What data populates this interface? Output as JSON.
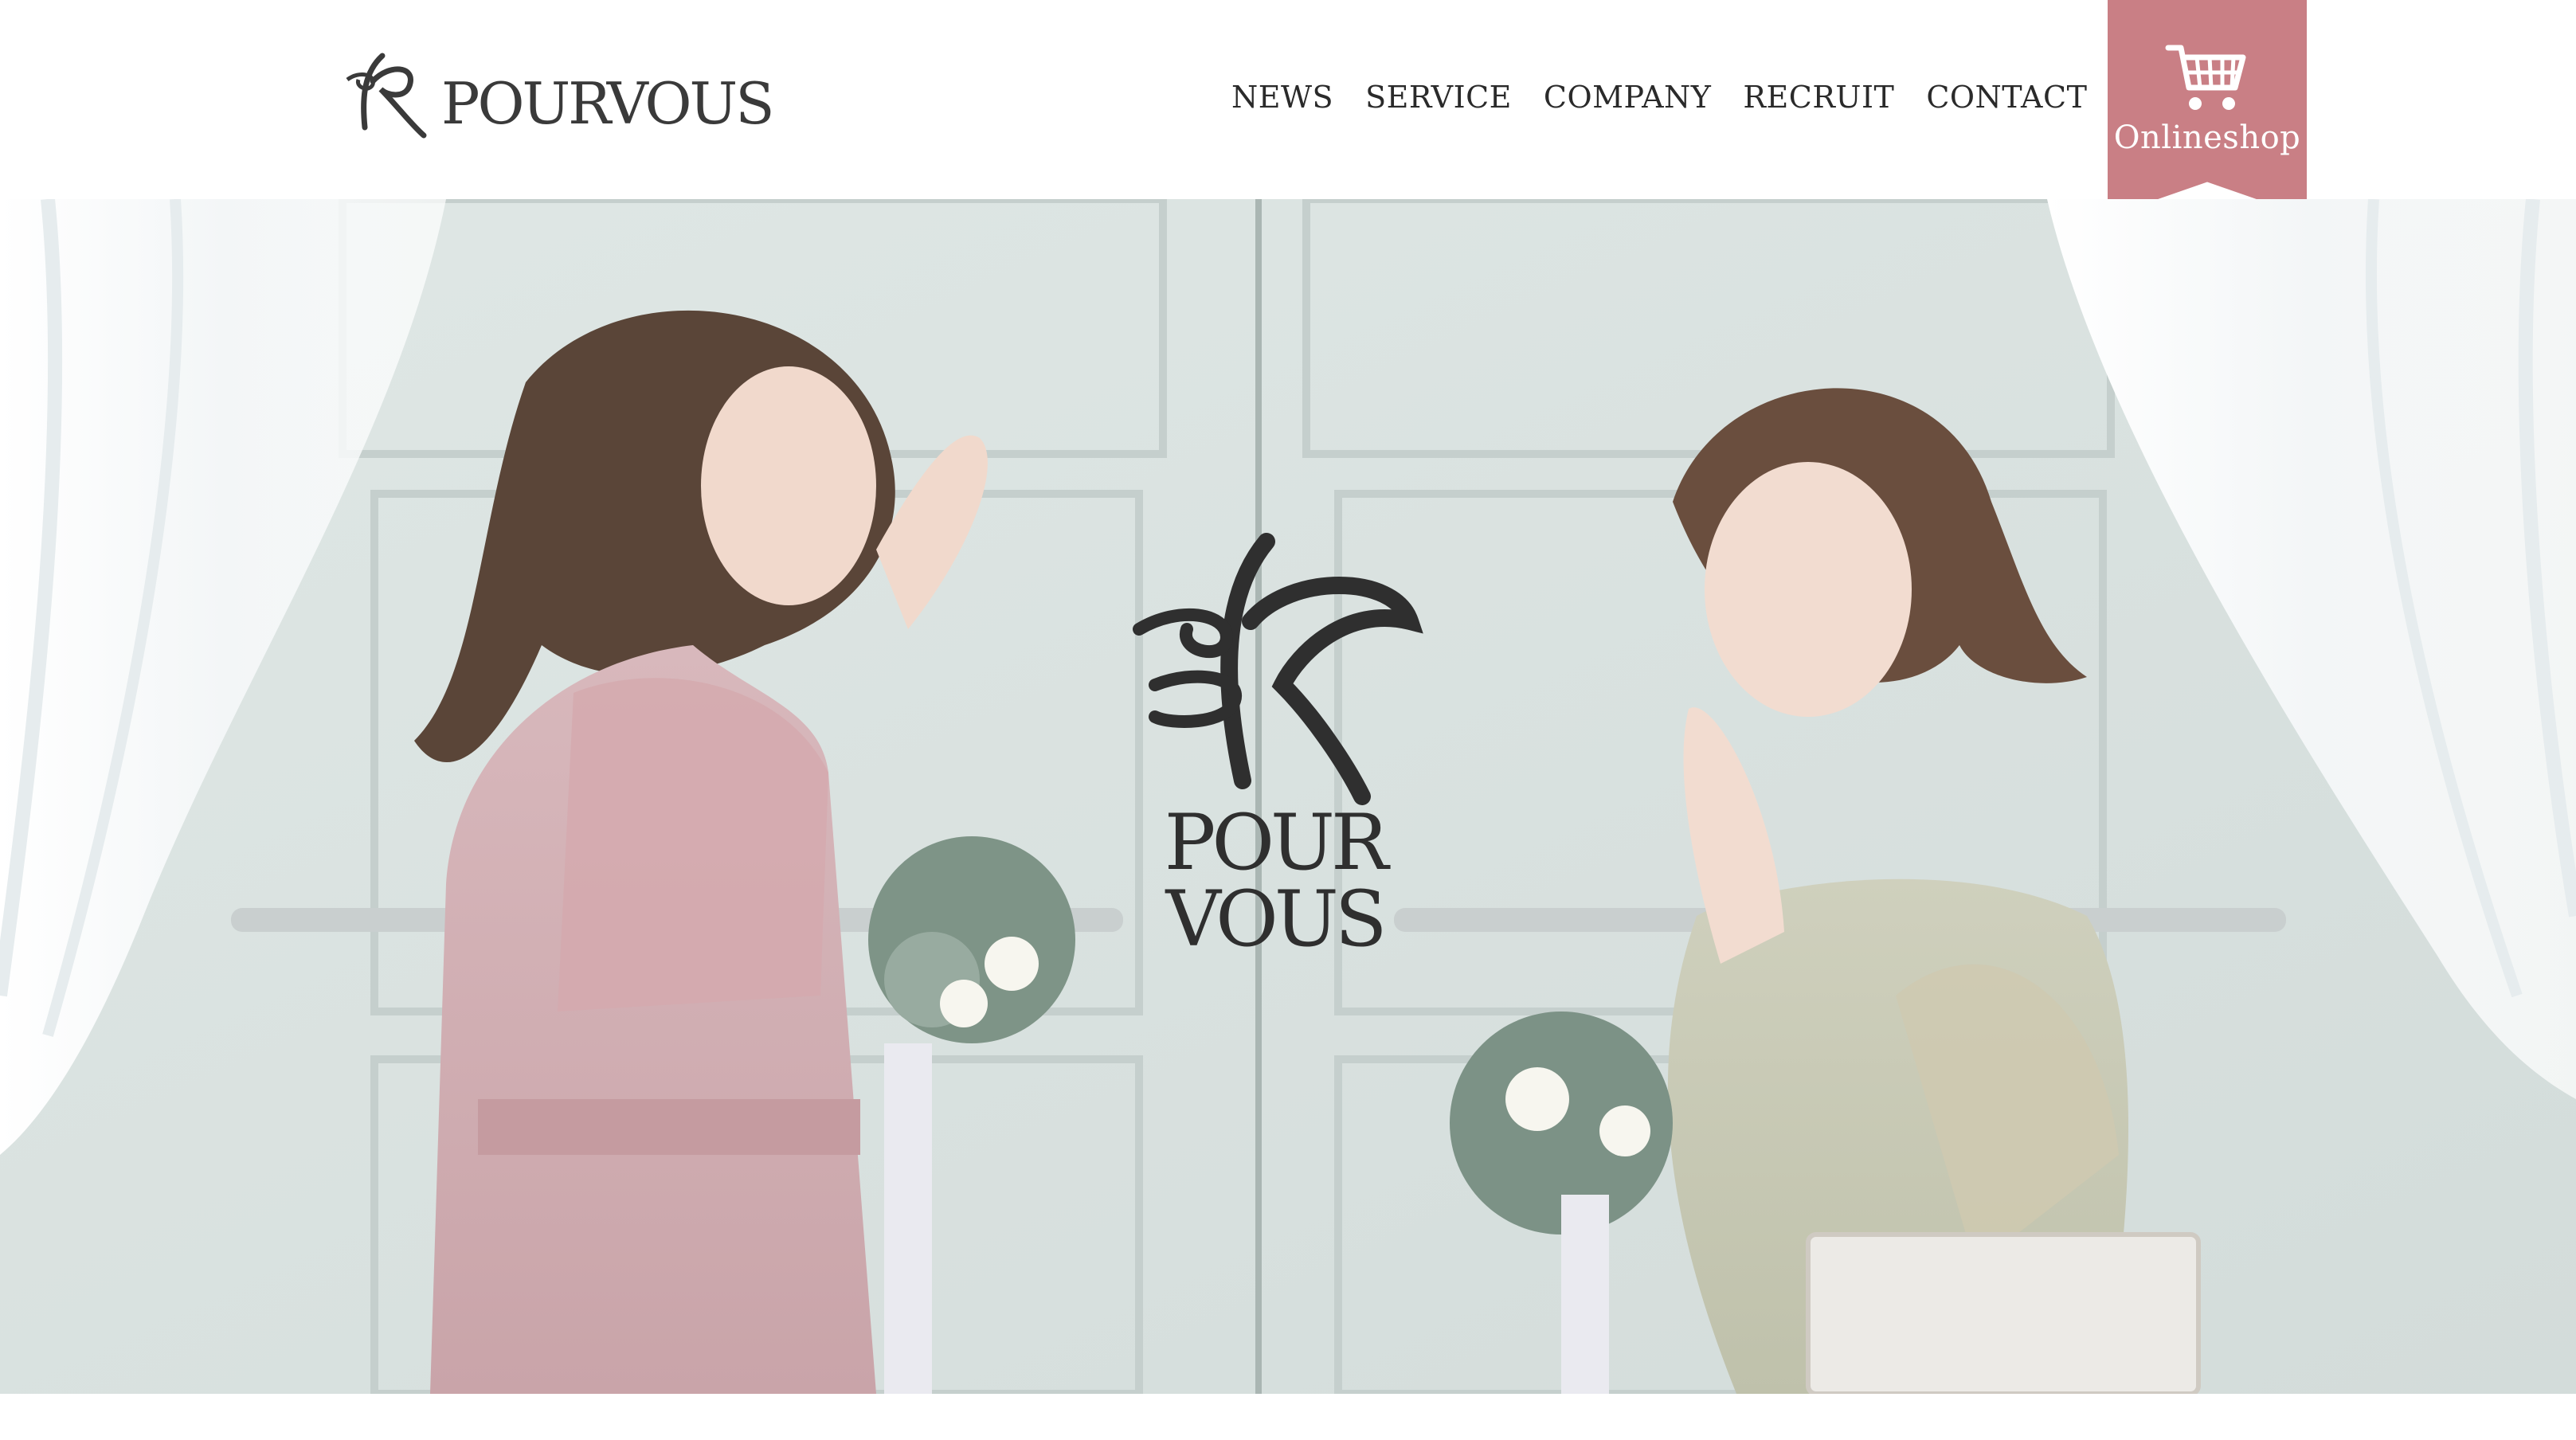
{
  "brand": {
    "name": "POURVOUS",
    "hero_wordmark": "POUR VOUS"
  },
  "nav": {
    "items": [
      {
        "label": "NEWS"
      },
      {
        "label": "SERVICE"
      },
      {
        "label": "COMPANY"
      },
      {
        "label": "RECRUIT"
      },
      {
        "label": "CONTACT"
      }
    ]
  },
  "shop": {
    "label": "Onlineshop",
    "icon": "shopping-cart-icon"
  },
  "colors": {
    "accent": "#c97f85",
    "text": "#2a2a2a",
    "header_bg": "#ffffff"
  }
}
